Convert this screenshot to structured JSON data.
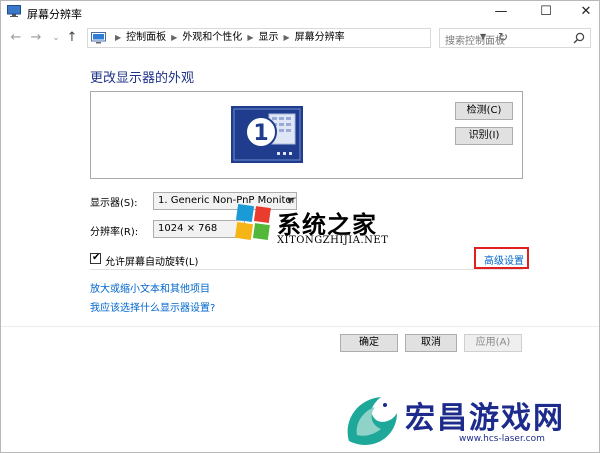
{
  "window": {
    "title": "屏幕分辨率",
    "minimize": "—",
    "maximize": "☐",
    "close": "✕"
  },
  "nav": {
    "back": "←",
    "forward": "→",
    "dropdown": "⌄",
    "up": "↑"
  },
  "address": {
    "crumbs": [
      "控制面板",
      "外观和个性化",
      "显示",
      "屏幕分辨率"
    ],
    "separator": "▶",
    "dropdown": "▼",
    "refresh": "↻"
  },
  "search": {
    "placeholder": "搜索控制面板"
  },
  "main": {
    "heading": "更改显示器的外观",
    "monitor_number": "1",
    "detect_button": "检测(C)",
    "identify_button": "识别(I)",
    "display_label": "显示器(S):",
    "display_value": "1. Generic Non-PnP Monitor",
    "resolution_label": "分辨率(R):",
    "resolution_value": "1024 × 768",
    "rotation_checkbox_label": "允许屏幕自动旋转(L)",
    "rotation_checked": true,
    "advanced_link": "高级设置",
    "link_text_size": "放大或缩小文本和其他项目",
    "link_which_settings": "我应该选择什么显示器设置?"
  },
  "footer": {
    "ok": "确定",
    "cancel": "取消",
    "apply": "应用(A)"
  },
  "watermarks": {
    "site1_title": "系统之家",
    "site1_sub": "XITONGZHIJIA.NET",
    "site2_title": "宏昌游戏网",
    "site2_url": "www.hcs-laser.com"
  },
  "colors": {
    "heading": "#1e3287",
    "link": "#0066cc",
    "highlight_box": "#e02020",
    "monitor_blue": "#1f3d8c",
    "watermark2": "#1d2b8c"
  }
}
